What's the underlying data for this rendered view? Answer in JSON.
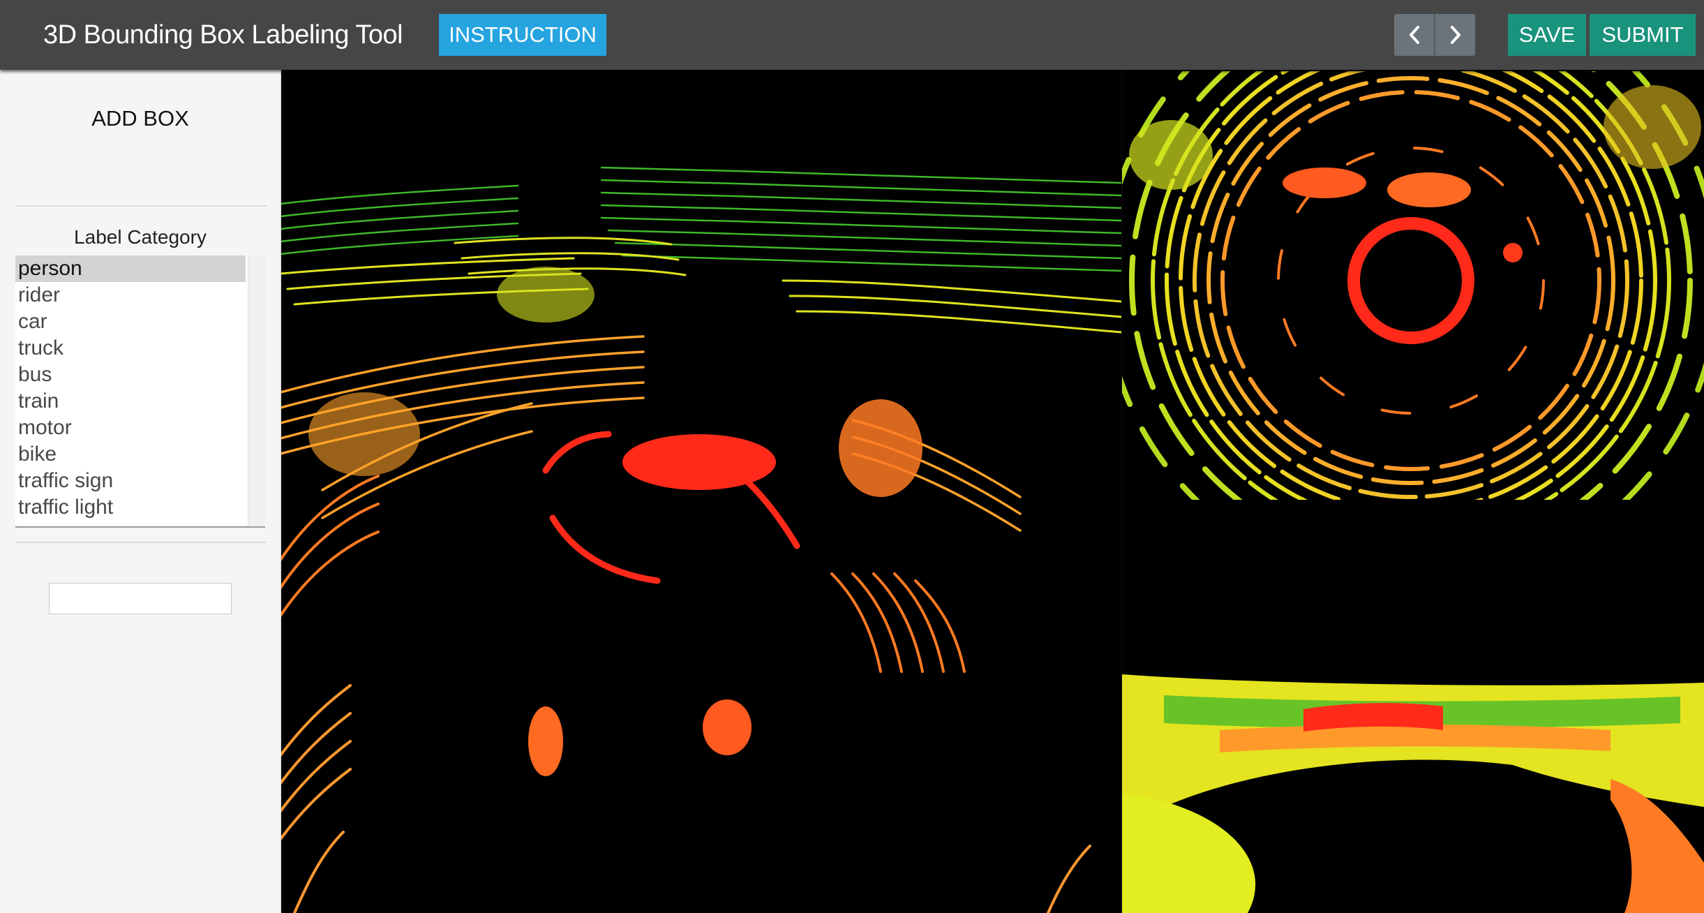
{
  "header": {
    "title": "3D Bounding Box Labeling Tool",
    "instruction_label": "INSTRUCTION",
    "prev_icon": "chevron-left-icon",
    "next_icon": "chevron-right-icon",
    "save_label": "SAVE",
    "submit_label": "SUBMIT"
  },
  "sidebar": {
    "add_box_label": "ADD BOX",
    "category_title": "Label Category",
    "categories": [
      "person",
      "rider",
      "car",
      "truck",
      "bus",
      "train",
      "motor",
      "bike",
      "traffic sign",
      "traffic light"
    ],
    "selected_category": "person",
    "input_value": "",
    "input_placeholder": ""
  },
  "views": {
    "main": "perspective-point-cloud-view",
    "top": "top-down-point-cloud-view",
    "side": "side-point-cloud-view"
  },
  "colors": {
    "header_bg": "#464646",
    "instruction_bg": "#25a4e0",
    "nav_bg": "#6b747b",
    "save_submit_bg": "#1a937c",
    "sidebar_bg": "#f5f5f5",
    "selected_item_bg": "#d3d3d3",
    "viewport_bg": "#000000",
    "points_near": "#ff2a1a",
    "points_mid": "#ff9a2a",
    "points_far": "#e8ee20",
    "points_farthest": "#33c020"
  }
}
